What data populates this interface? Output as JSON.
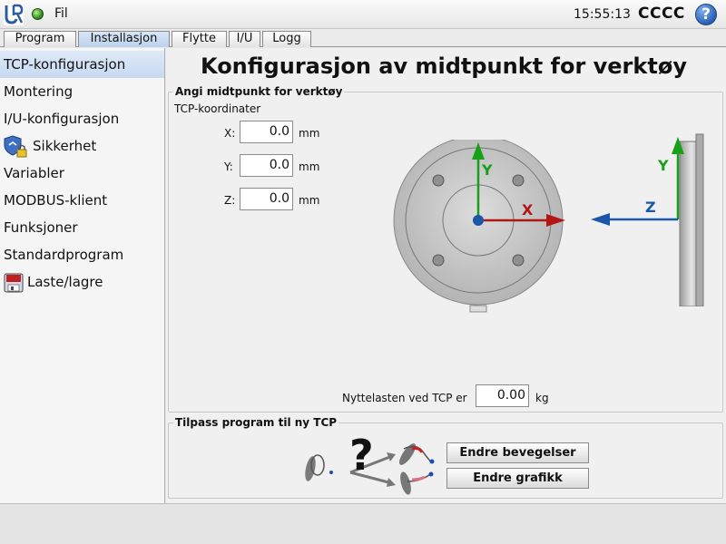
{
  "topbar": {
    "logo": "UR",
    "file_menu": "Fil",
    "time": "15:55:13",
    "user": "CCCC",
    "help_label": "?"
  },
  "tabs": [
    {
      "label": "Program"
    },
    {
      "label": "Installasjon"
    },
    {
      "label": "Flytte"
    },
    {
      "label": "I/U"
    },
    {
      "label": "Logg"
    }
  ],
  "active_tab": "Installasjon",
  "sidebar": {
    "items": [
      {
        "label": "TCP-konfigurasjon"
      },
      {
        "label": "Montering"
      },
      {
        "label": "I/U-konfigurasjon"
      },
      {
        "label": "Sikkerhet",
        "icon": "shield-lock-icon"
      },
      {
        "label": "Variabler"
      },
      {
        "label": "MODBUS-klient"
      },
      {
        "label": "Funksjoner"
      },
      {
        "label": "Standardprogram"
      },
      {
        "label": "Laste/lagre",
        "icon": "floppy-disk-icon"
      }
    ]
  },
  "main": {
    "title": "Konfigurasjon av midtpunkt for verktøy",
    "tcp_group": {
      "label": "Angi midtpunkt for verktøy",
      "subtitle": "TCP-koordinater",
      "x": {
        "label": "X:",
        "value": "0.0",
        "unit": "mm"
      },
      "y": {
        "label": "Y:",
        "value": "0.0",
        "unit": "mm"
      },
      "z": {
        "label": "Z:",
        "value": "0.0",
        "unit": "mm"
      },
      "diagram": {
        "front_x": "X",
        "front_y": "Y",
        "side_y": "Y",
        "side_z": "Z"
      },
      "payload": {
        "label": "Nyttelasten ved TCP er",
        "value": "0.00",
        "unit": "kg"
      }
    },
    "adjust_group": {
      "label": "Tilpass program til ny TCP",
      "question_mark": "?",
      "change_motions_button": "Endre bevegelser",
      "change_graphics_button": "Endre grafikk"
    }
  },
  "colors": {
    "axis_x": "#b31515",
    "axis_y": "#18a018",
    "axis_z": "#1b57a8",
    "active_blue": "#c7d9f1"
  }
}
